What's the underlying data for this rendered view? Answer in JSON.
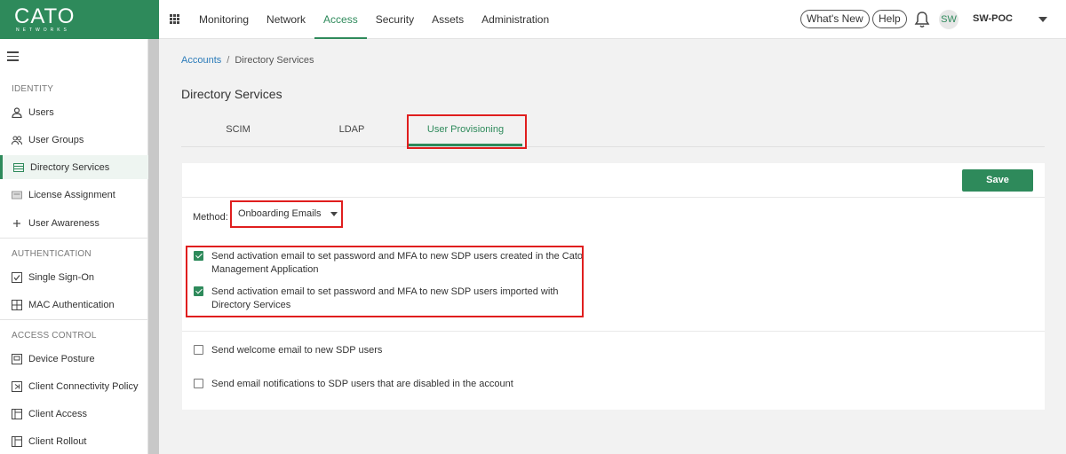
{
  "brand": {
    "name": "CATO",
    "tagline": "NETWORKS",
    "color": "#2e8a5b"
  },
  "topnav": {
    "items": [
      "Monitoring",
      "Network",
      "Access",
      "Security",
      "Assets",
      "Administration"
    ],
    "active": "Access",
    "whats_new": "What's New",
    "help": "Help",
    "avatar_initials": "SW",
    "account": "SW-POC"
  },
  "sidebar": {
    "sections": [
      {
        "title": "IDENTITY",
        "items": [
          {
            "label": "Users",
            "icon": "user-icon"
          },
          {
            "label": "User Groups",
            "icon": "users-icon"
          },
          {
            "label": "Directory Services",
            "icon": "list-icon",
            "active": true
          },
          {
            "label": "License Assignment",
            "icon": "license-icon"
          },
          {
            "label": "User Awareness",
            "icon": "plus-icon"
          }
        ]
      },
      {
        "title": "AUTHENTICATION",
        "items": [
          {
            "label": "Single Sign-On",
            "icon": "checkbox-icon"
          },
          {
            "label": "MAC Authentication",
            "icon": "grid-icon"
          }
        ]
      },
      {
        "title": "ACCESS CONTROL",
        "items": [
          {
            "label": "Device Posture",
            "icon": "device-icon"
          },
          {
            "label": "Client Connectivity Policy",
            "icon": "policy-icon"
          },
          {
            "label": "Client Access",
            "icon": "panel-icon"
          },
          {
            "label": "Client Rollout",
            "icon": "panel-icon"
          }
        ]
      }
    ]
  },
  "breadcrumb": {
    "parent": "Accounts",
    "separator": "/",
    "current": "Directory Services"
  },
  "page_title": "Directory Services",
  "tabs": [
    {
      "label": "SCIM"
    },
    {
      "label": "LDAP"
    },
    {
      "label": "User Provisioning",
      "active": true
    }
  ],
  "form": {
    "save": "Save",
    "method_label": "Method:",
    "method_value": "Onboarding Emails",
    "options": [
      {
        "label": "Send activation email to set password and MFA to new SDP users created in the Cato Management Application",
        "checked": true
      },
      {
        "label": "Send activation email to set password and MFA to new SDP users imported with Directory Services",
        "checked": true
      },
      {
        "label": "Send welcome email to new SDP users",
        "checked": false
      },
      {
        "label": "Send email notifications to SDP users that are disabled in the account",
        "checked": false
      }
    ]
  }
}
